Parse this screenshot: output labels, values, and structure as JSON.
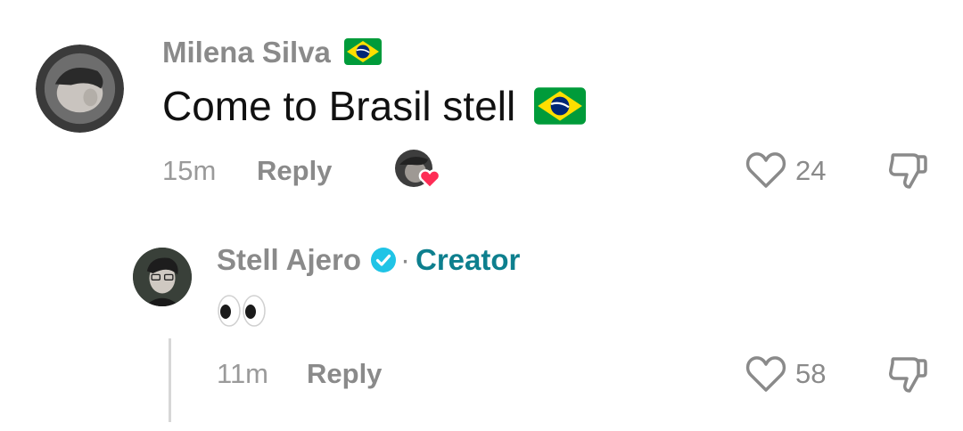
{
  "comments": [
    {
      "username": "Milena Silva",
      "username_flag": "brazil-flag-icon",
      "text": "Come to Brasil stell",
      "text_flag": "brazil-flag-icon",
      "time": "15m",
      "reply_label": "Reply",
      "creator_liked": true,
      "like_count": "24"
    }
  ],
  "replies": [
    {
      "username": "Stell Ajero",
      "verified": true,
      "separator": "·",
      "badge": "Creator",
      "text_emoji": "eyes-emoji",
      "time": "11m",
      "reply_label": "Reply",
      "like_count": "58"
    }
  ],
  "colors": {
    "creator_badge": "#0d7f8e",
    "verified": "#20c4e6",
    "heart_badge": "#fe2c55",
    "brazil_green": "#009b3a",
    "brazil_yellow": "#fedf00",
    "brazil_blue": "#002776"
  }
}
